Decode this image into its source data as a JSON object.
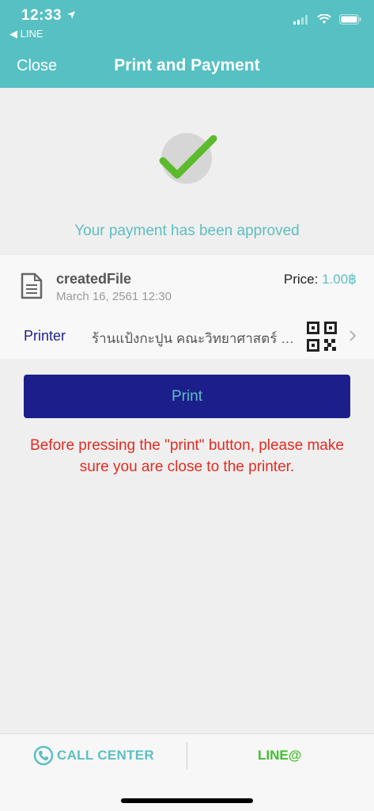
{
  "status_bar": {
    "time": "12:33",
    "back_app": "LINE"
  },
  "nav": {
    "close": "Close",
    "title": "Print and Payment"
  },
  "result": {
    "message": "Your payment has been approved"
  },
  "file": {
    "name": "createdFile",
    "date": "March 16, 2561 12:30",
    "price_label": "Price:",
    "price_value": "1.00฿"
  },
  "printer": {
    "label": "Printer",
    "name": "ร้านแป้งกะปูน คณะวิทยาศาสตร์ จุฬา"
  },
  "print_button": {
    "label": "Print"
  },
  "warning": {
    "text": "Before pressing the \"print\" button, please make sure you are close to the printer."
  },
  "bottom": {
    "call_center": "CALL CENTER",
    "line_at": "LINE@"
  },
  "colors": {
    "header": "#56c0c2",
    "accent": "#5dbfc0",
    "button": "#1c1e8c",
    "warning": "#e32b21",
    "check": "#5bbb2c",
    "line": "#3fbf2a"
  }
}
